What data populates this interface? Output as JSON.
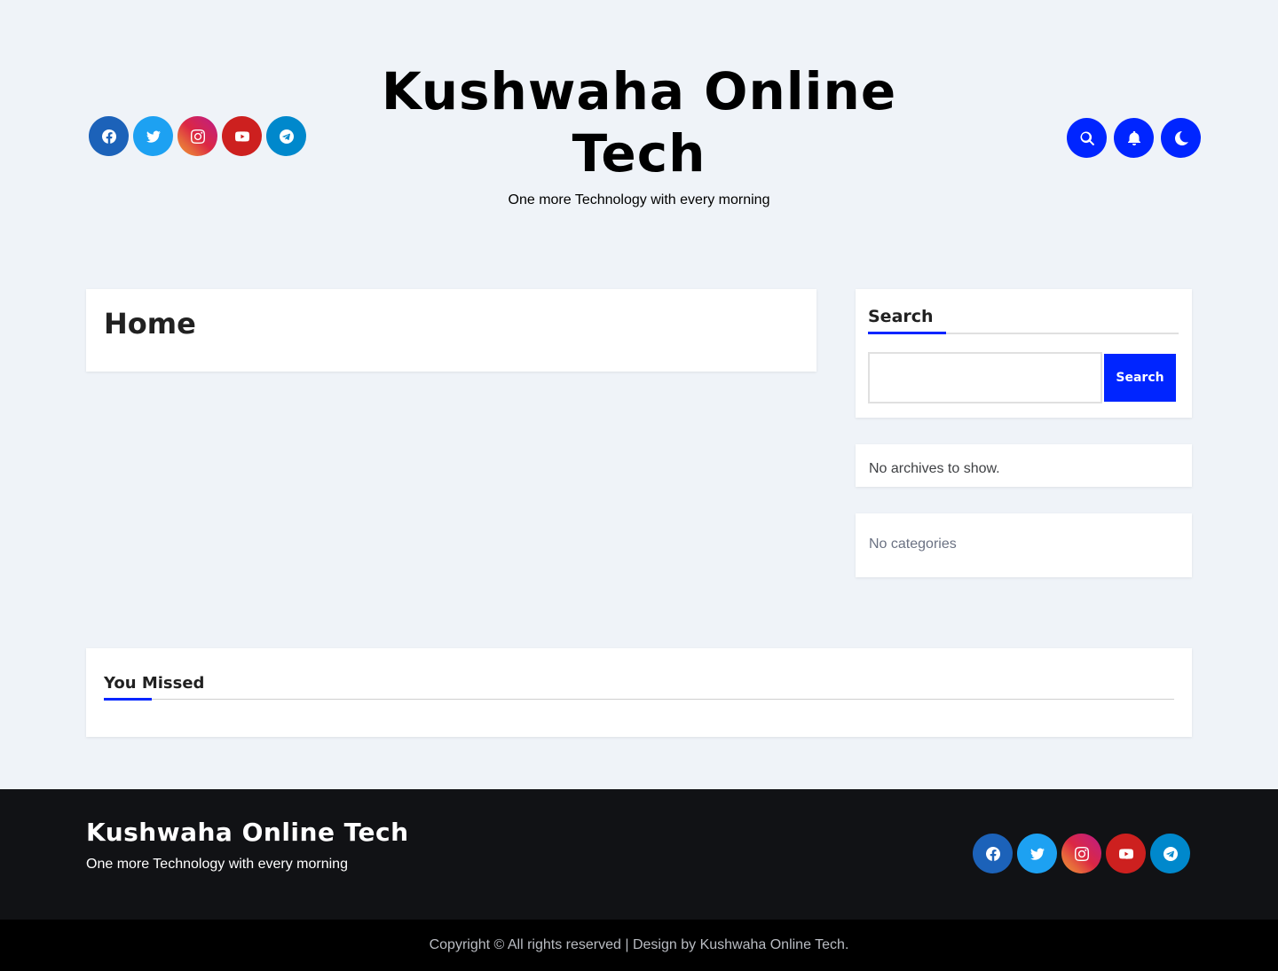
{
  "site": {
    "title": "Kushwaha Online Tech",
    "tagline": "One more Technology with every morning"
  },
  "social": [
    {
      "name": "facebook",
      "icon": "facebook-icon",
      "color": "#1c62b9"
    },
    {
      "name": "twitter",
      "icon": "twitter-icon",
      "color": "#1da1f2"
    },
    {
      "name": "instagram",
      "icon": "instagram-icon",
      "color": "#dc2743"
    },
    {
      "name": "youtube",
      "icon": "youtube-icon",
      "color": "#cd201f"
    },
    {
      "name": "telegram",
      "icon": "telegram-icon",
      "color": "#0088cc"
    }
  ],
  "header_actions": [
    "search-icon",
    "bell-icon",
    "moon-icon"
  ],
  "main": {
    "page_title": "Home"
  },
  "sidebar": {
    "search": {
      "title": "Search",
      "button_label": "Search",
      "value": "",
      "placeholder": ""
    },
    "archives_text": "No archives to show.",
    "categories_text": "No categories"
  },
  "you_missed": {
    "title": "You Missed"
  },
  "footer": {
    "title": "Kushwaha Online Tech",
    "tagline": "One more Technology with every morning",
    "copyright_text": "Copyright © All rights reserved | Design by ",
    "copyright_link": "Kushwaha Online Tech",
    "copyright_end": "."
  },
  "colors": {
    "accent": "#0025ff",
    "background": "#eff3f8",
    "footer_bg": "#111215",
    "copyright_bg": "#000000"
  }
}
